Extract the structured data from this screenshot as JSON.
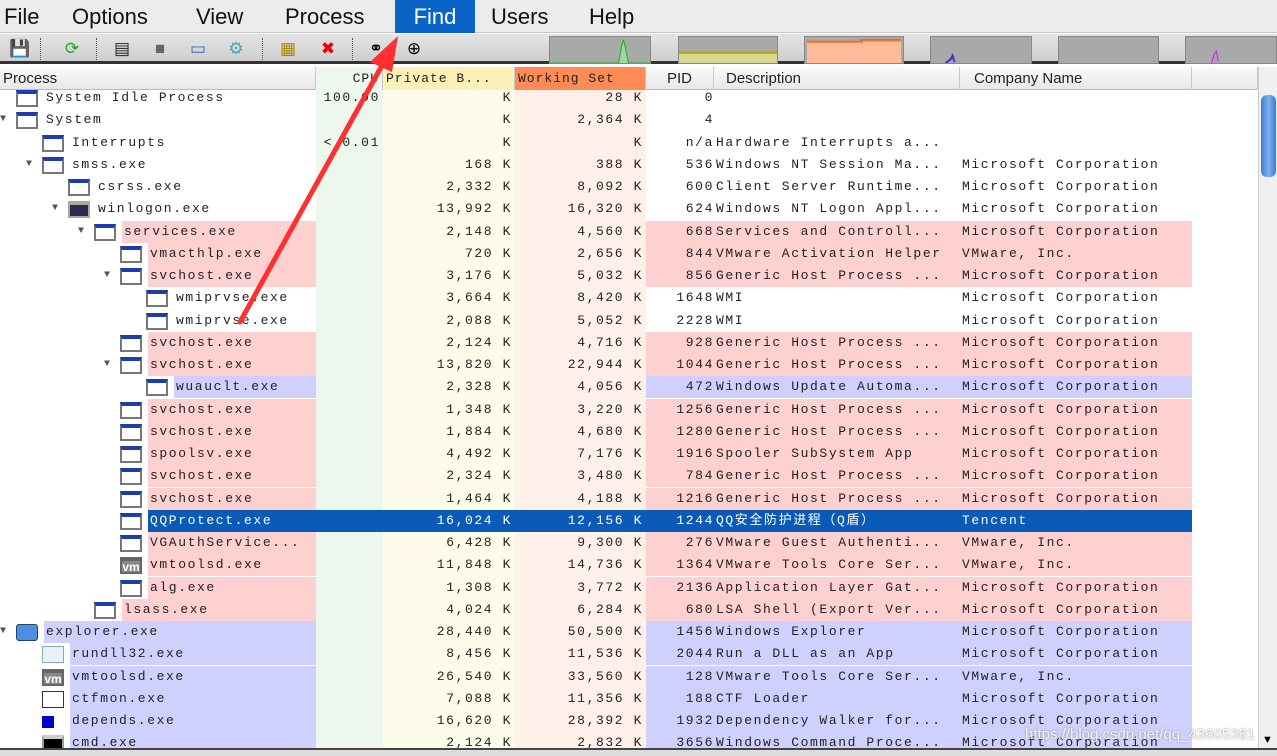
{
  "menu": [
    {
      "label": "File"
    },
    {
      "label": "Options"
    },
    {
      "label": "View"
    },
    {
      "label": "Process"
    },
    {
      "label": "Find",
      "active": true
    },
    {
      "label": "Users"
    },
    {
      "label": "Help"
    }
  ],
  "toolbar": {
    "icons": [
      "save-icon",
      "refresh-icon",
      "system-info-icon",
      "handle-view-icon",
      "window-icon",
      "dll-icon",
      "properties-icon",
      "kill-process-icon",
      "find-binoculars-icon",
      "find-window-crosshair-icon"
    ]
  },
  "graphs": [
    "cpu-graph",
    "commit-graph",
    "physical-memory-graph",
    "io-graph",
    "network-graph",
    "disk-graph"
  ],
  "columns": {
    "process": "Process",
    "cpu": "CPU",
    "private": "Private B...",
    "ws": "Working Set",
    "pid": "PID",
    "desc": "Description",
    "company": "Company Name"
  },
  "colors": {
    "service": "#ffd0d0",
    "own": "#d0d0ff",
    "selected": "#0a5ab8",
    "cpu_col": "#eef7ee",
    "private_col": "#fdfbea",
    "ws_col": "#fff0ea",
    "ws_header": "#ff8c55",
    "find_menu": "#0a64c8"
  },
  "rows": [
    {
      "name": "System Idle Process",
      "level": 0,
      "exp": false,
      "icon": "window",
      "cpu": "100.00",
      "private": "K",
      "ws": "28 K",
      "pid": "0",
      "desc": "",
      "company": "",
      "kind": ""
    },
    {
      "name": "System",
      "level": 0,
      "exp": true,
      "icon": "window",
      "cpu": "",
      "private": "K",
      "ws": "2,364 K",
      "pid": "4",
      "desc": "",
      "company": "",
      "kind": ""
    },
    {
      "name": "Interrupts",
      "level": 1,
      "exp": false,
      "icon": "window",
      "cpu": "< 0.01",
      "private": "K",
      "ws": "K",
      "pid": "n/a",
      "desc": "Hardware Interrupts a...",
      "company": "",
      "kind": ""
    },
    {
      "name": "smss.exe",
      "level": 1,
      "exp": true,
      "icon": "window",
      "cpu": "",
      "private": "168 K",
      "ws": "388 K",
      "pid": "536",
      "desc": "Windows NT Session Ma...",
      "company": "Microsoft Corporation",
      "kind": ""
    },
    {
      "name": "csrss.exe",
      "level": 2,
      "exp": false,
      "icon": "window",
      "cpu": "",
      "private": "2,332 K",
      "ws": "8,092 K",
      "pid": "600",
      "desc": "Client Server Runtime...",
      "company": "Microsoft Corporation",
      "kind": ""
    },
    {
      "name": "winlogon.exe",
      "level": 2,
      "exp": true,
      "icon": "lock",
      "cpu": "",
      "private": "13,992 K",
      "ws": "16,320 K",
      "pid": "624",
      "desc": "Windows NT Logon Appl...",
      "company": "Microsoft Corporation",
      "kind": ""
    },
    {
      "name": "services.exe",
      "level": 3,
      "exp": true,
      "icon": "window",
      "cpu": "",
      "private": "2,148 K",
      "ws": "4,560 K",
      "pid": "668",
      "desc": "Services and Controll...",
      "company": "Microsoft Corporation",
      "kind": "service"
    },
    {
      "name": "vmacthlp.exe",
      "level": 4,
      "exp": false,
      "icon": "window",
      "cpu": "",
      "private": "720 K",
      "ws": "2,656 K",
      "pid": "844",
      "desc": "VMware Activation Helper",
      "company": "VMware, Inc.",
      "kind": "service"
    },
    {
      "name": "svchost.exe",
      "level": 4,
      "exp": true,
      "icon": "window",
      "cpu": "",
      "private": "3,176 K",
      "ws": "5,032 K",
      "pid": "856",
      "desc": "Generic Host Process ...",
      "company": "Microsoft Corporation",
      "kind": "service"
    },
    {
      "name": "wmiprvse.exe",
      "level": 5,
      "exp": false,
      "icon": "window",
      "cpu": "",
      "private": "3,664 K",
      "ws": "8,420 K",
      "pid": "1648",
      "desc": "WMI",
      "company": "Microsoft Corporation",
      "kind": ""
    },
    {
      "name": "wmiprvse.exe",
      "level": 5,
      "exp": false,
      "icon": "window",
      "cpu": "",
      "private": "2,088 K",
      "ws": "5,052 K",
      "pid": "2228",
      "desc": "WMI",
      "company": "Microsoft Corporation",
      "kind": ""
    },
    {
      "name": "svchost.exe",
      "level": 4,
      "exp": false,
      "icon": "window",
      "cpu": "",
      "private": "2,124 K",
      "ws": "4,716 K",
      "pid": "928",
      "desc": "Generic Host Process ...",
      "company": "Microsoft Corporation",
      "kind": "service"
    },
    {
      "name": "svchost.exe",
      "level": 4,
      "exp": true,
      "icon": "window",
      "cpu": "",
      "private": "13,820 K",
      "ws": "22,944 K",
      "pid": "1044",
      "desc": "Generic Host Process ...",
      "company": "Microsoft Corporation",
      "kind": "service"
    },
    {
      "name": "wuauclt.exe",
      "level": 5,
      "exp": false,
      "icon": "window",
      "cpu": "",
      "private": "2,328 K",
      "ws": "4,056 K",
      "pid": "472",
      "desc": "Windows Update Automa...",
      "company": "Microsoft Corporation",
      "kind": "own"
    },
    {
      "name": "svchost.exe",
      "level": 4,
      "exp": false,
      "icon": "window",
      "cpu": "",
      "private": "1,348 K",
      "ws": "3,220 K",
      "pid": "1256",
      "desc": "Generic Host Process ...",
      "company": "Microsoft Corporation",
      "kind": "service"
    },
    {
      "name": "svchost.exe",
      "level": 4,
      "exp": false,
      "icon": "window",
      "cpu": "",
      "private": "1,884 K",
      "ws": "4,680 K",
      "pid": "1280",
      "desc": "Generic Host Process ...",
      "company": "Microsoft Corporation",
      "kind": "service"
    },
    {
      "name": "spoolsv.exe",
      "level": 4,
      "exp": false,
      "icon": "window",
      "cpu": "",
      "private": "4,492 K",
      "ws": "7,176 K",
      "pid": "1916",
      "desc": "Spooler SubSystem App",
      "company": "Microsoft Corporation",
      "kind": "service"
    },
    {
      "name": "svchost.exe",
      "level": 4,
      "exp": false,
      "icon": "window",
      "cpu": "",
      "private": "2,324 K",
      "ws": "3,480 K",
      "pid": "784",
      "desc": "Generic Host Process ...",
      "company": "Microsoft Corporation",
      "kind": "service"
    },
    {
      "name": "svchost.exe",
      "level": 4,
      "exp": false,
      "icon": "window",
      "cpu": "",
      "private": "1,464 K",
      "ws": "4,188 K",
      "pid": "1216",
      "desc": "Generic Host Process ...",
      "company": "Microsoft Corporation",
      "kind": "service"
    },
    {
      "name": "QQProtect.exe",
      "level": 4,
      "exp": false,
      "icon": "window",
      "cpu": "",
      "private": "16,024 K",
      "ws": "12,156 K",
      "pid": "1244",
      "desc": "QQ安全防护进程（Q盾）",
      "company": "Tencent",
      "kind": "selected"
    },
    {
      "name": "VGAuthService...",
      "level": 4,
      "exp": false,
      "icon": "window",
      "cpu": "",
      "private": "6,428 K",
      "ws": "9,300 K",
      "pid": "276",
      "desc": "VMware Guest Authenti...",
      "company": "VMware, Inc.",
      "kind": "service"
    },
    {
      "name": "vmtoolsd.exe",
      "level": 4,
      "exp": false,
      "icon": "vm",
      "cpu": "",
      "private": "11,848 K",
      "ws": "14,736 K",
      "pid": "1364",
      "desc": "VMware Tools Core Ser...",
      "company": "VMware, Inc.",
      "kind": "service"
    },
    {
      "name": "alg.exe",
      "level": 4,
      "exp": false,
      "icon": "window",
      "cpu": "",
      "private": "1,308 K",
      "ws": "3,772 K",
      "pid": "2136",
      "desc": "Application Layer Gat...",
      "company": "Microsoft Corporation",
      "kind": "service"
    },
    {
      "name": "lsass.exe",
      "level": 3,
      "exp": false,
      "icon": "window",
      "cpu": "",
      "private": "4,024 K",
      "ws": "6,284 K",
      "pid": "680",
      "desc": "LSA Shell (Export Ver...",
      "company": "Microsoft Corporation",
      "kind": "service"
    },
    {
      "name": "explorer.exe",
      "level": 0,
      "exp": true,
      "icon": "computer",
      "cpu": "",
      "private": "28,440 K",
      "ws": "50,500 K",
      "pid": "1456",
      "desc": "Windows Explorer",
      "company": "Microsoft Corporation",
      "kind": "own"
    },
    {
      "name": "rundll32.exe",
      "level": 1,
      "exp": false,
      "icon": "doc",
      "cpu": "",
      "private": "8,456 K",
      "ws": "11,536 K",
      "pid": "2044",
      "desc": "Run a DLL as an App",
      "company": "Microsoft Corporation",
      "kind": "own"
    },
    {
      "name": "vmtoolsd.exe",
      "level": 1,
      "exp": false,
      "icon": "vm",
      "cpu": "",
      "private": "26,540 K",
      "ws": "33,560 K",
      "pid": "128",
      "desc": "VMware Tools Core Ser...",
      "company": "VMware, Inc.",
      "kind": "own"
    },
    {
      "name": "ctfmon.exe",
      "level": 1,
      "exp": false,
      "icon": "pen",
      "cpu": "",
      "private": "7,088 K",
      "ws": "11,356 K",
      "pid": "188",
      "desc": "CTF Loader",
      "company": "Microsoft Corporation",
      "kind": "own"
    },
    {
      "name": "depends.exe",
      "level": 1,
      "exp": false,
      "icon": "tree",
      "cpu": "",
      "private": "16,620 K",
      "ws": "28,392 K",
      "pid": "1932",
      "desc": "Dependency Walker for...",
      "company": "Microsoft Corporation",
      "kind": "own"
    },
    {
      "name": "cmd.exe",
      "level": 1,
      "exp": false,
      "icon": "cmd",
      "cpu": "",
      "private": "2,124 K",
      "ws": "2,832 K",
      "pid": "3656",
      "desc": "Windows Command Proce...",
      "company": "Microsoft Corporation",
      "kind": "own"
    }
  ],
  "watermark": "https://blog.csdn.net/qq_43605381"
}
